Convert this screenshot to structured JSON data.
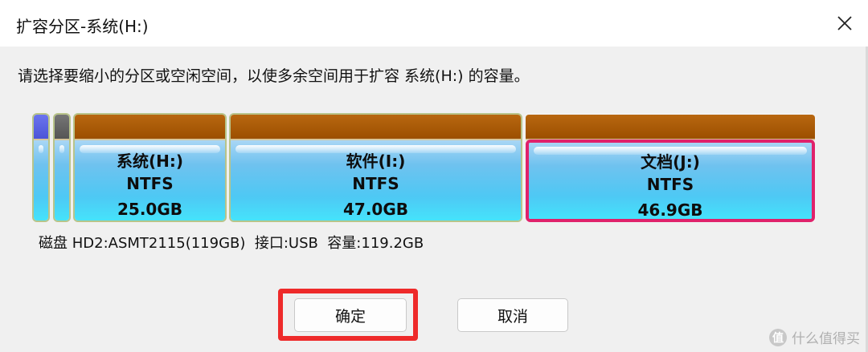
{
  "window": {
    "title": "扩容分区-系统(H:)",
    "close_icon": "close-icon"
  },
  "prompt": "请选择要缩小的分区或空闲空间，以使多余空间用于扩容 系统(H:) 的容量。",
  "partitions": [
    {
      "name": "",
      "fs": "",
      "size": "",
      "color": "#5560e0"
    },
    {
      "name": "",
      "fs": "",
      "size": "",
      "color": "#666666"
    },
    {
      "name": "系统(H:)",
      "fs": "NTFS",
      "size": "25.0GB"
    },
    {
      "name": "软件(I:)",
      "fs": "NTFS",
      "size": "47.0GB"
    },
    {
      "name": "文档(J:)",
      "fs": "NTFS",
      "size": "46.9GB",
      "selected": true
    }
  ],
  "disk_info": "磁盘 HD2:ASMT2115(119GB)  接口:USB  容量:119.2GB",
  "buttons": {
    "ok": "确定",
    "cancel": "取消"
  },
  "watermark": {
    "badge": "值",
    "text": "什么值得买"
  },
  "colors": {
    "partition_cap": "#a65500",
    "partition_fill": "#4ec8f4",
    "selection_border": "#e0226b",
    "highlight_box": "#ee2a2a"
  }
}
